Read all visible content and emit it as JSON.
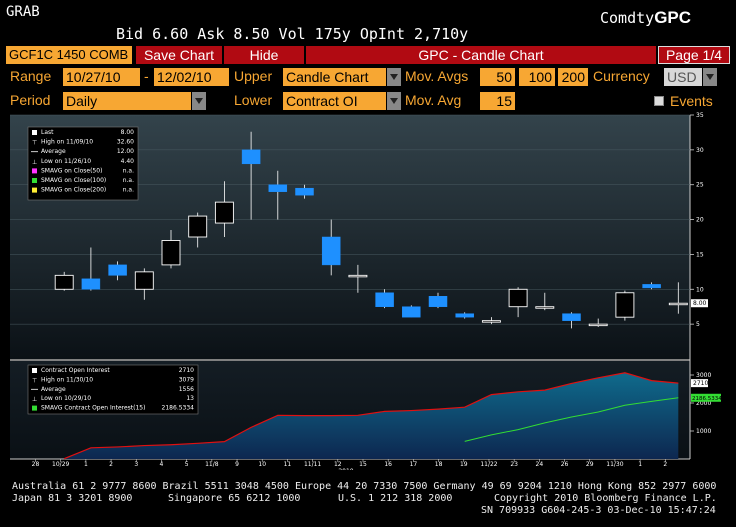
{
  "header": {
    "title": "GRAB",
    "quote": "Bid 6.60  Ask 8.50 Vol 175y OpInt 2,710y",
    "brand_prefix": "Comdty",
    "brand_suffix": "GPC"
  },
  "toolbar": {
    "security": "GCF1C 1450 COMB",
    "save_label": "Save Chart",
    "hide_label": "Hide",
    "window_title": "GPC - Candle Chart",
    "page": "Page 1/4"
  },
  "controls": {
    "range_label": "Range",
    "range_start": "10/27/10",
    "range_sep": "-",
    "range_end": "12/02/10",
    "upper_label": "Upper",
    "upper_value": "Candle Chart",
    "mov_avgs_label": "Mov. Avgs",
    "mov_avgs": [
      "50",
      "100",
      "200"
    ],
    "currency_label": "Currency",
    "currency_value": "USD",
    "period_label": "Period",
    "period_value": "Daily",
    "lower_label": "Lower",
    "lower_value": "Contract OI",
    "mov_avg_label": "Mov. Avg",
    "mov_avg_value": "15",
    "events_label": "Events"
  },
  "upper_legend": [
    {
      "label": "Last",
      "value": "8.00"
    },
    {
      "label": "High on 11/09/10",
      "value": "32.60"
    },
    {
      "label": "Average",
      "value": "12.00"
    },
    {
      "label": "Low on 11/26/10",
      "value": "4.40"
    },
    {
      "label": "SMAVG on Close(50)",
      "value": "n.a."
    },
    {
      "label": "SMAVG on Close(100)",
      "value": "n.a."
    },
    {
      "label": "SMAVG on Close(200)",
      "value": "n.a."
    }
  ],
  "lower_legend": [
    {
      "label": "Contract Open Interest",
      "value": "2710"
    },
    {
      "label": "High on 11/30/10",
      "value": "3079"
    },
    {
      "label": "Average",
      "value": "1556"
    },
    {
      "label": "Low on 10/29/10",
      "value": "13"
    },
    {
      "label": "SMAVG Contract Open Interest(15)",
      "value": "2186.5334"
    }
  ],
  "colors": {
    "accent": "#f7a733",
    "red": "#b10a12",
    "bull": "#ffffff",
    "bear": "#1e90ff",
    "oi_line": "#e01010",
    "sma_line": "#33dd33"
  },
  "chart_data": [
    {
      "type": "candlestick",
      "ylim": [
        0,
        35
      ],
      "yticks": [
        "35",
        "30",
        "25",
        "20",
        "15",
        "10",
        "5"
      ],
      "last_label": "8.00",
      "x": [
        "10/29",
        "11/1",
        "11/2",
        "11/3",
        "11/4",
        "11/5",
        "11/8",
        "11/9",
        "11/10",
        "11/11",
        "11/12",
        "11/15",
        "11/16",
        "11/17",
        "11/18",
        "11/19",
        "11/22",
        "11/23",
        "11/24",
        "11/26",
        "11/29",
        "11/30",
        "12/1",
        "12/2"
      ],
      "open": [
        10.0,
        11.5,
        13.5,
        10.0,
        13.5,
        17.5,
        19.5,
        30.0,
        25.0,
        24.5,
        17.5,
        12.0,
        9.5,
        7.5,
        9.0,
        6.5,
        5.5,
        7.5,
        7.5,
        6.5,
        5.0,
        6.0,
        10.7,
        8.0
      ],
      "close": [
        12.0,
        10.0,
        12.0,
        12.5,
        17.0,
        20.5,
        22.5,
        28.0,
        24.0,
        23.5,
        13.5,
        12.0,
        7.5,
        6.0,
        7.5,
        6.0,
        5.5,
        10.0,
        7.5,
        5.5,
        5.0,
        9.5,
        10.2,
        8.0
      ],
      "high": [
        12.5,
        16.0,
        14.0,
        13.0,
        18.5,
        21.0,
        25.5,
        32.6,
        27.0,
        25.0,
        20.0,
        13.5,
        10.0,
        7.7,
        9.5,
        6.7,
        6.0,
        10.3,
        9.5,
        6.7,
        5.8,
        9.8,
        11.0,
        11.0
      ],
      "low": [
        9.8,
        9.8,
        11.3,
        8.5,
        13.0,
        16.0,
        17.5,
        20.0,
        20.0,
        23.0,
        12.0,
        9.5,
        7.3,
        6.0,
        7.3,
        5.8,
        5.0,
        6.0,
        7.0,
        4.4,
        4.6,
        5.5,
        10.0,
        6.5
      ]
    },
    {
      "type": "area",
      "ylim": [
        0,
        3500
      ],
      "yticks": [
        "3000",
        "2000",
        "1000"
      ],
      "last_label": "2710",
      "sma_label": "2186.5334",
      "x": [
        "10/28",
        "10/29",
        "11/1",
        "11/2",
        "11/3",
        "11/4",
        "11/5",
        "11/8",
        "11/9",
        "11/10",
        "11/11",
        "11/12",
        "11/15",
        "11/16",
        "11/17",
        "11/18",
        "11/19",
        "11/22",
        "11/23",
        "11/24",
        "11/26",
        "11/29",
        "11/30",
        "12/1",
        "12/2"
      ],
      "open_interest": [
        null,
        13,
        400,
        430,
        480,
        510,
        560,
        620,
        1130,
        1560,
        1550,
        1550,
        1560,
        1700,
        1730,
        1780,
        1850,
        2300,
        2400,
        2460,
        2700,
        2900,
        3079,
        2800,
        2710
      ],
      "sma": [
        null,
        null,
        null,
        null,
        null,
        null,
        null,
        null,
        null,
        null,
        null,
        null,
        null,
        null,
        null,
        null,
        630,
        860,
        1050,
        1290,
        1500,
        1680,
        1920,
        2060,
        2186.5334
      ],
      "xlabels": [
        "28",
        "10/29",
        "1",
        "2",
        "3",
        "4",
        "5",
        "11/8",
        "9",
        "10",
        "11",
        "11/11",
        "12",
        "15",
        "16",
        "17",
        "18",
        "19",
        "11/22",
        "23",
        "24",
        "26",
        "29",
        "11/30",
        "1",
        "2"
      ],
      "year_label": "2010"
    }
  ],
  "footer": {
    "line1": "Australia 61 2 9777 8600 Brazil 5511 3048 4500 Europe 44 20 7330 7500 Germany 49 69 9204 1210 Hong Kong 852 2977 6000",
    "line2a": "Japan 81 3 3201 8900",
    "line2b": "Singapore 65 6212 1000",
    "line2c": "U.S. 1 212 318 2000",
    "line2d": "Copyright 2010 Bloomberg Finance L.P.",
    "line3": "SN 709933 G604-245-3 03-Dec-10 15:47:24"
  }
}
